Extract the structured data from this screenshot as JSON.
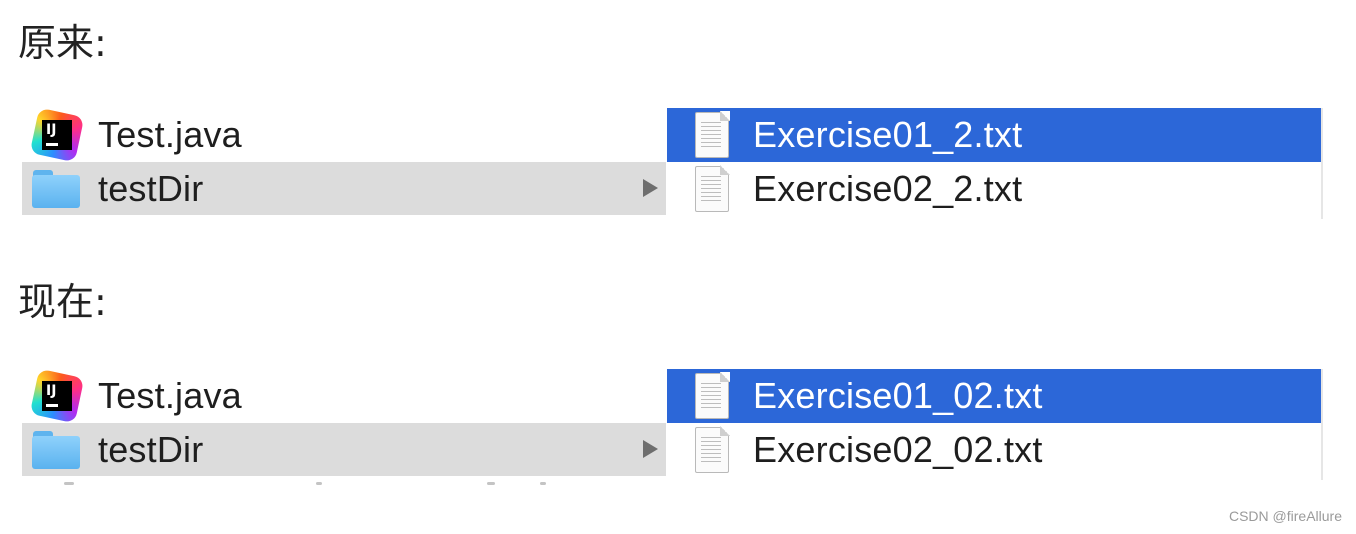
{
  "sections": [
    {
      "heading": "原来:",
      "left_items": [
        {
          "icon": "intellij-idea-icon",
          "label": "Test.java"
        },
        {
          "icon": "folder-icon",
          "label": "testDir",
          "selected": true
        }
      ],
      "right_items": [
        {
          "icon": "text-document-icon",
          "label": "Exercise01_2.txt",
          "selected": true
        },
        {
          "icon": "text-document-icon",
          "label": "Exercise02_2.txt"
        }
      ]
    },
    {
      "heading": "现在:",
      "left_items": [
        {
          "icon": "intellij-idea-icon",
          "label": "Test.java"
        },
        {
          "icon": "folder-icon",
          "label": "testDir",
          "selected": true
        }
      ],
      "right_items": [
        {
          "icon": "text-document-icon",
          "label": "Exercise01_02.txt",
          "selected": true
        },
        {
          "icon": "text-document-icon",
          "label": "Exercise02_02.txt"
        }
      ]
    }
  ],
  "colors": {
    "selection_active": "#2c67d8",
    "selection_inactive": "#dcdcdc",
    "folder": "#6fc0f7"
  },
  "watermark": "CSDN @fireAllure"
}
